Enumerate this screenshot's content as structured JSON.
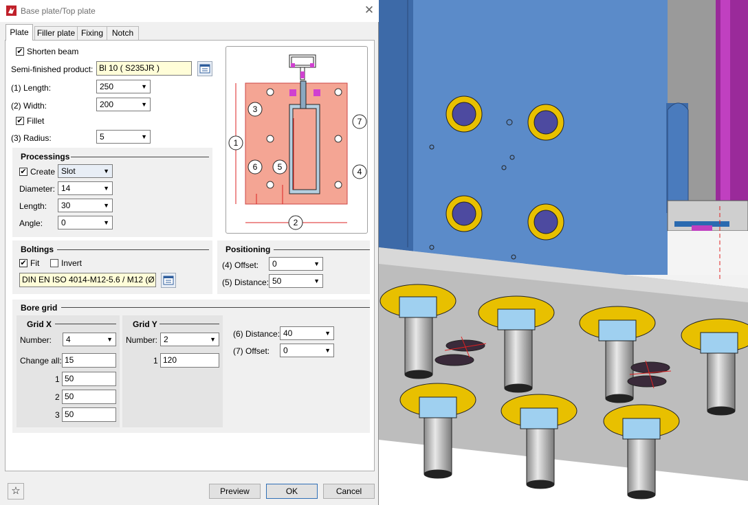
{
  "window": {
    "title": "Base plate/Top plate",
    "close_glyph": "✕",
    "app_icon": "app-logo-icon"
  },
  "tabs": [
    "Plate",
    "Filler plate",
    "Fixing",
    "Notch"
  ],
  "plate": {
    "shorten_beam": {
      "label": "Shorten beam",
      "checked": true
    },
    "semi_finished": {
      "label": "Semi-finished product:",
      "value": "Bl 10  ( S235JR )"
    },
    "length": {
      "label": "(1) Length:",
      "value": "250"
    },
    "width": {
      "label": "(2) Width:",
      "value": "200"
    },
    "fillet": {
      "label": "Fillet",
      "checked": true
    },
    "radius": {
      "label": "(3) Radius:",
      "value": "5"
    }
  },
  "processings": {
    "title": "Processings",
    "create": {
      "label": "Create",
      "checked": true,
      "value": "Slot"
    },
    "diameter": {
      "label": "Diameter:",
      "value": "14"
    },
    "length": {
      "label": "Length:",
      "value": "30"
    },
    "angle": {
      "label": "Angle:",
      "value": "0"
    }
  },
  "diagram": {
    "callouts": [
      "1",
      "2",
      "3",
      "4",
      "5",
      "6",
      "7"
    ]
  },
  "boltings": {
    "title": "Boltings",
    "fit": {
      "label": "Fit",
      "checked": true
    },
    "invert": {
      "label": "Invert",
      "checked": false
    },
    "bolt": "DIN EN ISO 4014-M12-5.6 / M12 (Ø"
  },
  "positioning": {
    "title": "Positioning",
    "offset": {
      "label": "(4) Offset:",
      "value": "0"
    },
    "distance": {
      "label": "(5) Distance:",
      "value": "50"
    }
  },
  "bore_grid": {
    "title": "Bore grid",
    "grid_x": {
      "title": "Grid X",
      "number_label": "Number:",
      "number": "4",
      "change_all_label": "Change all:",
      "change_all": "15",
      "rows": [
        {
          "index": "1",
          "value": "50"
        },
        {
          "index": "2",
          "value": "50"
        },
        {
          "index": "3",
          "value": "50"
        }
      ]
    },
    "grid_y": {
      "title": "Grid Y",
      "number_label": "Number:",
      "number": "2",
      "rows": [
        {
          "index": "1",
          "value": "120"
        }
      ]
    },
    "distance": {
      "label": "(6) Distance:",
      "value": "40"
    },
    "offset": {
      "label": "(7) Offset:",
      "value": "0"
    }
  },
  "footer": {
    "star_icon": "star-icon",
    "preview": "Preview",
    "ok": "OK",
    "cancel": "Cancel"
  },
  "colors": {
    "accent": "#2f6fb6",
    "plate": "#f4a594",
    "steel": "#5b8bc9",
    "washer": "#e8c000"
  }
}
